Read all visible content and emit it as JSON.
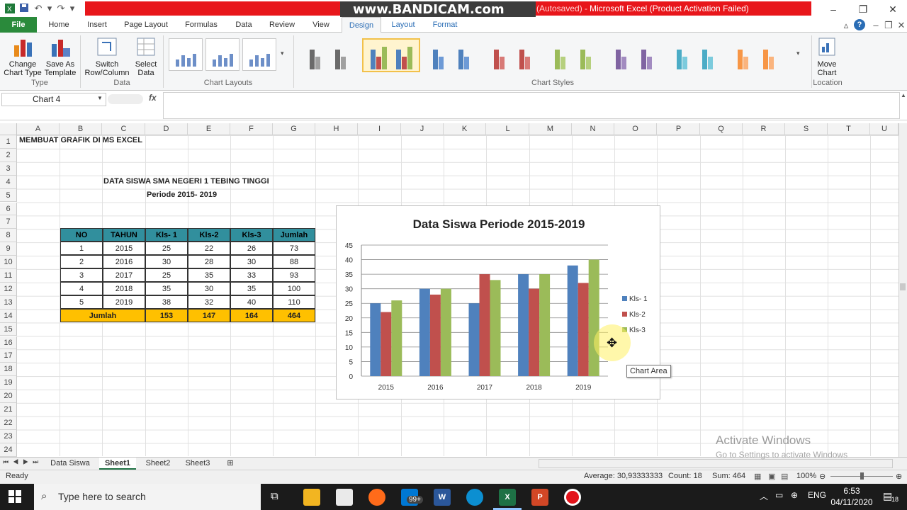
{
  "window": {
    "watermark": "www.BANDICAM.com",
    "title": "Microsoft Excel (Product Activation Failed)",
    "title_prefix": "(Autosaved) -"
  },
  "tabs": [
    "File",
    "Home",
    "Insert",
    "Page Layout",
    "Formulas",
    "Data",
    "Review",
    "View",
    "Design",
    "Layout",
    "Format"
  ],
  "ribbon": {
    "type_group": {
      "label": "Type",
      "buttons": [
        "Change Chart Type",
        "Save As Template"
      ]
    },
    "data_group": {
      "label": "Data",
      "buttons": [
        "Switch Row/Column",
        "Select Data"
      ]
    },
    "layouts_label": "Chart Layouts",
    "styles_label": "Chart Styles",
    "location_group": {
      "label": "Location",
      "button": "Move Chart"
    }
  },
  "formula_bar": {
    "name_box": "Chart 4",
    "fx": "fx",
    "formula": ""
  },
  "columns": [
    "A",
    "B",
    "C",
    "D",
    "E",
    "F",
    "G",
    "H",
    "I",
    "J",
    "K",
    "L",
    "M",
    "N",
    "O",
    "P",
    "Q",
    "R",
    "S",
    "T",
    "U"
  ],
  "rows": [
    "1",
    "2",
    "3",
    "4",
    "5",
    "6",
    "7",
    "8",
    "9",
    "10",
    "11",
    "12",
    "13",
    "14",
    "15",
    "16",
    "17",
    "18",
    "19",
    "20",
    "21",
    "22",
    "23",
    "24"
  ],
  "sheet": {
    "a1": "MEMBUAT GRAFIK DI MS EXCEL",
    "heading1": "DATA SISWA SMA NEGERI 1 TEBING TINGGI",
    "heading2": "Periode 2015- 2019",
    "table_headers": [
      "NO",
      "TAHUN",
      "Kls- 1",
      "Kls-2",
      "Kls-3",
      "Jumlah"
    ],
    "table_rows": [
      [
        "1",
        "2015",
        "25",
        "22",
        "26",
        "73"
      ],
      [
        "2",
        "2016",
        "30",
        "28",
        "30",
        "88"
      ],
      [
        "3",
        "2017",
        "25",
        "35",
        "33",
        "93"
      ],
      [
        "4",
        "2018",
        "35",
        "30",
        "35",
        "100"
      ],
      [
        "5",
        "2019",
        "38",
        "32",
        "40",
        "110"
      ]
    ],
    "total_row": [
      "Jumlah",
      "153",
      "147",
      "164",
      "464"
    ]
  },
  "chart_data": {
    "type": "bar",
    "title": "Data Siswa Periode 2015-2019",
    "categories": [
      "2015",
      "2016",
      "2017",
      "2018",
      "2019"
    ],
    "series": [
      {
        "name": "Kls- 1",
        "values": [
          25,
          30,
          25,
          35,
          38
        ],
        "color": "#4f81bd"
      },
      {
        "name": "Kls-2",
        "values": [
          22,
          28,
          35,
          30,
          32
        ],
        "color": "#c0504d"
      },
      {
        "name": "Kls-3",
        "values": [
          26,
          30,
          33,
          35,
          40
        ],
        "color": "#9bbb59"
      }
    ],
    "yticks": [
      "0",
      "5",
      "10",
      "15",
      "20",
      "25",
      "30",
      "35",
      "40",
      "45"
    ],
    "ylim": [
      0,
      45
    ],
    "grid": true,
    "legend": "right"
  },
  "tooltip": "Chart Area",
  "sheet_tabs": [
    "Data Siswa",
    "Sheet1",
    "Sheet2",
    "Sheet3"
  ],
  "status": {
    "ready": "Ready",
    "average": "Average: 30,93333333",
    "count": "Count: 18",
    "sum": "Sum: 464",
    "zoom": "100%"
  },
  "activation": {
    "line1": "Activate Windows",
    "line2": "Go to Settings to activate Windows"
  },
  "taskbar": {
    "search_placeholder": "Type here to search",
    "badge": "99+",
    "lang": "ENG",
    "time": "6:53",
    "date": "04/11/2020",
    "notif": "18"
  }
}
